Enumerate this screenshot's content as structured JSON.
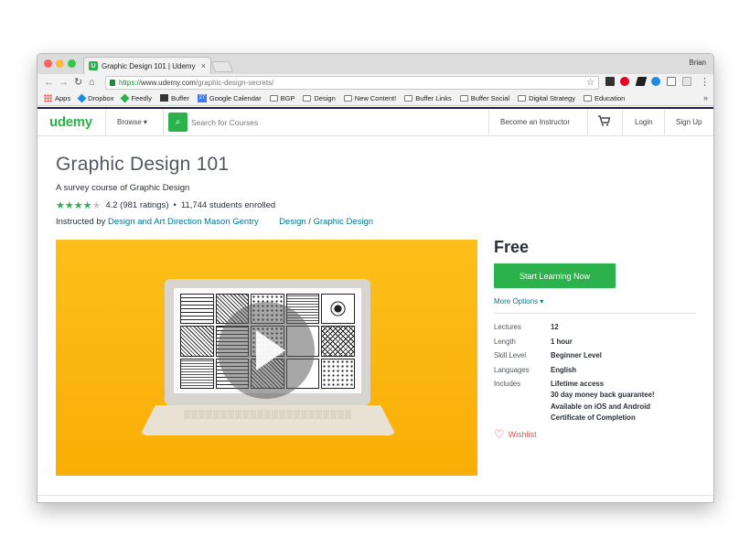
{
  "browser": {
    "tab_title": "Graphic Design 101 | Udemy",
    "tab_favicon": "U",
    "tab_close": "×",
    "profile": "Brian",
    "url_scheme": "https://",
    "url_host": "www.udemy.com",
    "url_path": "/graphic-design-secrets/",
    "back_icon": "←",
    "forward_icon": "→",
    "reload_icon": "↻",
    "home_icon": "⌂",
    "star_icon": "☆",
    "menu_icon": "⋮",
    "bookmarks": [
      {
        "label": "Apps",
        "icon": "apps-icon"
      },
      {
        "label": "Dropbox",
        "icon": "dropbox-icon"
      },
      {
        "label": "Feedly",
        "icon": "feedly-icon"
      },
      {
        "label": "Buffer",
        "icon": "buffer-icon"
      },
      {
        "label": "Google Calendar",
        "icon": "calendar-icon",
        "badge": "27"
      },
      {
        "label": "BGP",
        "icon": "folder-icon"
      },
      {
        "label": "Design",
        "icon": "folder-icon"
      },
      {
        "label": "New Content!",
        "icon": "folder-icon"
      },
      {
        "label": "Buffer Links",
        "icon": "folder-icon"
      },
      {
        "label": "Buffer Social",
        "icon": "folder-icon"
      },
      {
        "label": "Digital Strategy",
        "icon": "folder-icon"
      },
      {
        "label": "Education",
        "icon": "folder-icon"
      }
    ],
    "bookmarks_more": "»"
  },
  "header": {
    "logo": "udemy",
    "browse": "Browse ▾",
    "search_placeholder": "Search for Courses",
    "search_icon": "⌕",
    "become_instructor": "Become an Instructor",
    "cart_icon": "🛒",
    "login": "Login",
    "signup": "Sign Up"
  },
  "course": {
    "title": "Graphic Design 101",
    "subtitle": "A survey course of Graphic Design",
    "rating_value": 4.2,
    "stars_filled": "★★★★",
    "stars_empty": "★",
    "rating_text": "4.2 (981 ratings)",
    "bullet": "•",
    "enrolled": "11,744 students enrolled",
    "instructed_prefix": "Instructed by",
    "instructor": "Design and Art Direction Mason Gentry",
    "category": "Design",
    "category_sep": "/",
    "subcategory": "Graphic Design"
  },
  "purchase": {
    "price": "Free",
    "cta": "Start Learning Now",
    "more_options": "More Options ▾",
    "details": {
      "lectures_label": "Lectures",
      "lectures": "12",
      "length_label": "Length",
      "length": "1 hour",
      "skill_label": "Skill Level",
      "skill": "Beginner Level",
      "languages_label": "Languages",
      "languages": "English",
      "includes_label": "Includes",
      "includes": [
        "Lifetime access",
        "30 day money back guarantee!",
        "Available on iOS and Android",
        "Certificate of Completion"
      ]
    },
    "wishlist": "Wishlist",
    "heart_icon": "♡"
  },
  "colors": {
    "brand_green": "#2bb24c",
    "link_blue": "#007791",
    "hero_yellow": "#fdbb15",
    "wishlist_red": "#ec5252"
  }
}
